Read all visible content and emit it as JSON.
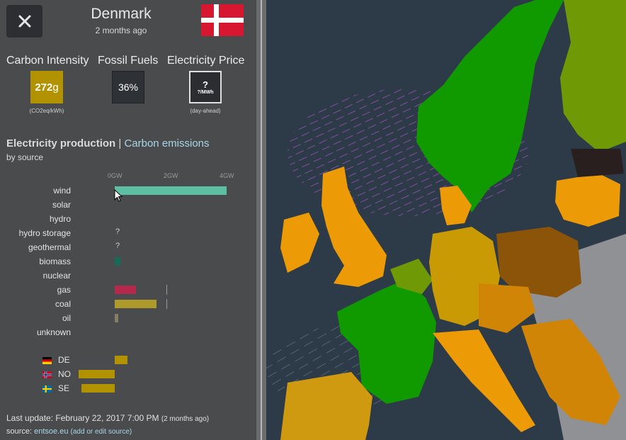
{
  "header": {
    "close_icon": "close-icon",
    "country": "Denmark",
    "age": "2 months ago",
    "flag_colors": {
      "red": "#d7172f",
      "white": "#ffffff"
    }
  },
  "kpis": {
    "carbon_intensity": {
      "label": "Carbon Intensity",
      "value": "272",
      "unit": "g",
      "sub": "(CO2eq/kWh)",
      "color": "#b39200"
    },
    "fossil_fuels": {
      "label": "Fossil Fuels",
      "value": "36%",
      "color": "#2e3135"
    },
    "electricity_price": {
      "label": "Electricity Price",
      "value": "?",
      "unit": "?/MWh",
      "sub": "(day-ahead)"
    }
  },
  "section": {
    "active_tab": "Electricity production",
    "separator": "|",
    "other_tab": "Carbon emissions",
    "subtitle": "by source"
  },
  "chart_data": {
    "type": "bar",
    "orientation": "horizontal",
    "x_unit": "GW",
    "ticks": [
      "0GW",
      "2GW",
      "4GW"
    ],
    "xlim": [
      0,
      4
    ],
    "categories": [
      "wind",
      "solar",
      "hydro",
      "hydro storage",
      "geothermal",
      "biomass",
      "nuclear",
      "gas",
      "coal",
      "oil",
      "unknown"
    ],
    "values": [
      4.0,
      0,
      0,
      null,
      null,
      0.2,
      0,
      0.75,
      1.5,
      0.12,
      0
    ],
    "capacity": {
      "gas": 1.85,
      "coal": 1.85
    },
    "colors": {
      "wind": "#5cbfa3",
      "biomass": "#166a57",
      "gas": "#b6294e",
      "coal": "#ad9a2a",
      "oil": "#867d66"
    },
    "unknown_marker": "?",
    "exchanges": [
      {
        "code": "DE",
        "value": 0.45,
        "color": "#b39200"
      },
      {
        "code": "NO",
        "value": -1.3,
        "color": "#b39200"
      },
      {
        "code": "SE",
        "value": -1.2,
        "color": "#b39200"
      }
    ]
  },
  "footer": {
    "last_update_label": "Last update: February 22, 2017 7:00 PM",
    "last_update_ago": "(2 months ago)",
    "source_label": "source:",
    "source_link": "entsoe.eu",
    "edit_link": "(add or edit source)"
  },
  "map_colors": {
    "sea": "#2d3a48",
    "green": "#119a00",
    "lightgreen": "#6f9a06",
    "orange": "#ec9a05",
    "darkorange": "#d08506",
    "brown": "#8c5409",
    "grey": "#8f9195",
    "wind": "#b05ad0"
  }
}
